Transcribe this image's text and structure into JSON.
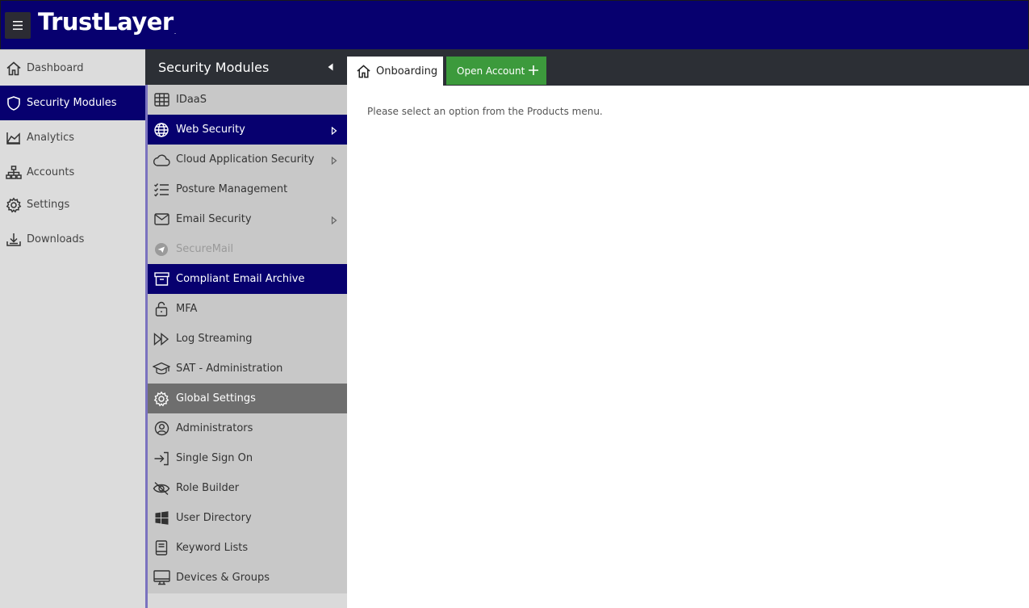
{
  "header": {
    "logo_text": "TrustLayer",
    "logo_mark": ".",
    "brand_color": "#07006f"
  },
  "leftnav": {
    "items": [
      {
        "label": "Dashboard",
        "icon": "home-icon"
      },
      {
        "label": "Security Modules",
        "icon": "shield-icon",
        "active": true
      },
      {
        "label": "Analytics",
        "icon": "chart-icon"
      },
      {
        "label": "Accounts",
        "icon": "org-chart-icon"
      },
      {
        "label": "Settings",
        "icon": "gear-icon"
      },
      {
        "label": "Downloads",
        "icon": "download-icon"
      }
    ]
  },
  "panel": {
    "title": "Security Modules",
    "items": [
      {
        "label": "IDaaS",
        "icon": "grid-icon"
      },
      {
        "label": "Web Security",
        "icon": "globe-icon",
        "active": true,
        "has_submenu": true
      },
      {
        "label": "Cloud Application Security",
        "icon": "cloud-icon",
        "has_submenu": true
      },
      {
        "label": "Posture Management",
        "icon": "checklist-icon"
      },
      {
        "label": "Email Security",
        "icon": "envelope-icon",
        "has_submenu": true
      },
      {
        "label": "SecureMail",
        "icon": "send-icon",
        "disabled": true
      },
      {
        "label": "Compliant Email Archive",
        "icon": "archive-icon",
        "active": true
      },
      {
        "label": "MFA",
        "icon": "unlock-icon"
      },
      {
        "label": "Log Streaming",
        "icon": "fast-forward-icon"
      },
      {
        "label": "SAT - Administration",
        "icon": "graduation-cap-icon"
      },
      {
        "label": "Global Settings",
        "icon": "gear-icon",
        "hover": true
      },
      {
        "label": "Administrators",
        "icon": "user-circle-icon"
      },
      {
        "label": "Single Sign On",
        "icon": "sign-in-icon"
      },
      {
        "label": "Role Builder",
        "icon": "eye-slash-icon"
      },
      {
        "label": "User Directory",
        "icon": "windows-icon"
      },
      {
        "label": "Keyword Lists",
        "icon": "book-icon"
      },
      {
        "label": "Devices & Groups",
        "icon": "monitor-icon"
      }
    ]
  },
  "tabs": {
    "home_label": "Onboarding",
    "open_account_label": "Open Account",
    "open_account_color": "#3c9a3c"
  },
  "main": {
    "message": "Please select an option from the Products menu."
  }
}
